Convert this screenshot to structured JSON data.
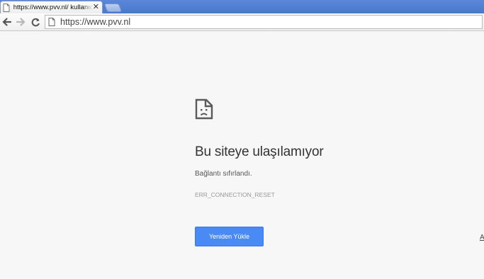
{
  "tab": {
    "title": "https://www.pvv.nl/ kullanıcı",
    "close_glyph": "✕"
  },
  "omnibox": {
    "url": "https://www.pvv.nl"
  },
  "error": {
    "icon": "sad-page-icon",
    "title": "Bu siteye ulaşılamıyor",
    "description": "Bağlantı sıfırlandı.",
    "code": "ERR_CONNECTION_RESET",
    "reload_label": "Yeniden Yükle",
    "details_label": "A"
  },
  "colors": {
    "tabstrip": "#4a78cc",
    "button": "#4a8af4",
    "page_background": "#f7f7f7"
  }
}
